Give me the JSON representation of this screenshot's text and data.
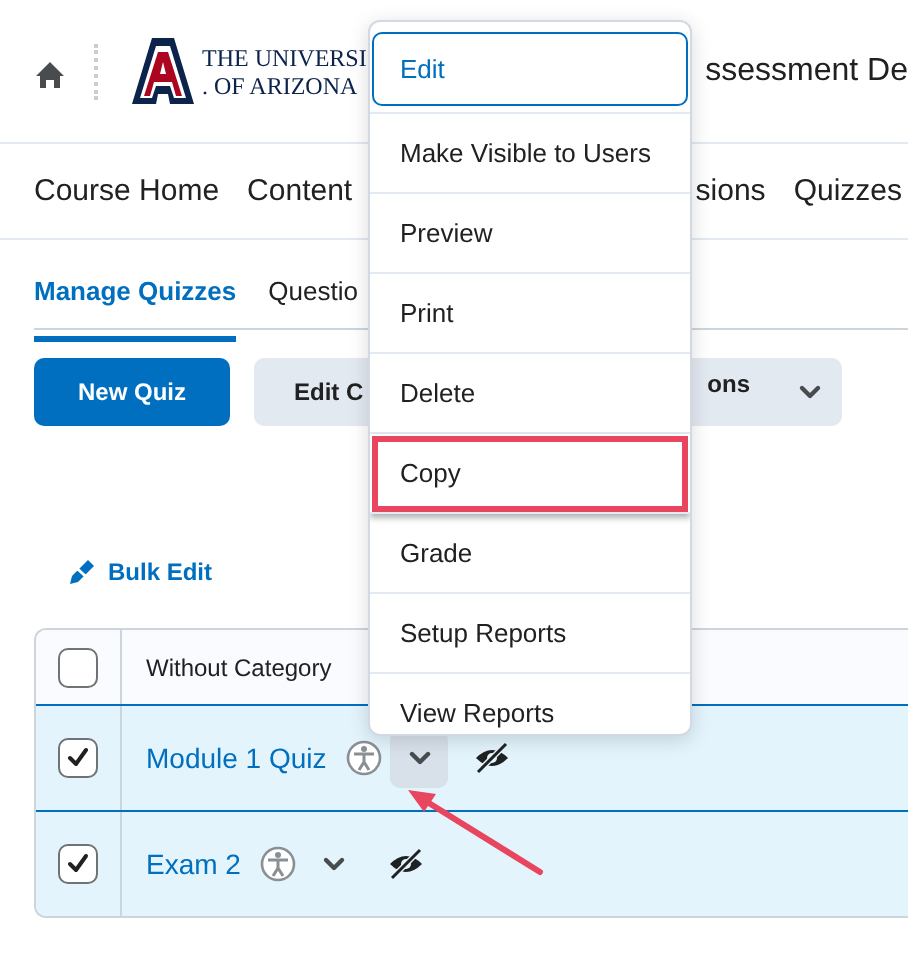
{
  "header": {
    "logo_line_1": "THE UNIVERSI",
    "logo_line_2": ". OF ARIZONA",
    "title": "ssessment De"
  },
  "nav": [
    {
      "label": "Course Home"
    },
    {
      "label": "Content"
    },
    {
      "label": "sions"
    },
    {
      "label": "Quizzes"
    }
  ],
  "tabs": [
    {
      "label": "Manage Quizzes",
      "selected": true
    },
    {
      "label": "Questio",
      "selected": false
    }
  ],
  "toolbar": {
    "new_button": "New Quiz",
    "edit_button": "Edit C",
    "more_button": "ons"
  },
  "bulk_edit": "Bulk Edit",
  "table": {
    "header": {
      "label": "Without Category",
      "checked": false
    },
    "rows": [
      {
        "title": "Module 1 Quiz",
        "checked": true,
        "menu_open": true
      },
      {
        "title": "Exam 2",
        "checked": true,
        "menu_open": false
      }
    ]
  },
  "context_menu": {
    "items": [
      {
        "label": "Edit",
        "focused": true,
        "annotated": false
      },
      {
        "label": "Make Visible to Users",
        "focused": false,
        "annotated": false
      },
      {
        "label": "Preview",
        "focused": false,
        "annotated": false
      },
      {
        "label": "Print",
        "focused": false,
        "annotated": false
      },
      {
        "label": "Delete",
        "focused": false,
        "annotated": false
      },
      {
        "label": "Copy",
        "focused": false,
        "annotated": true
      },
      {
        "label": "Grade",
        "focused": false,
        "annotated": false
      },
      {
        "label": "Setup Reports",
        "focused": false,
        "annotated": false
      },
      {
        "label": "View Reports",
        "focused": false,
        "annotated": false
      }
    ]
  }
}
